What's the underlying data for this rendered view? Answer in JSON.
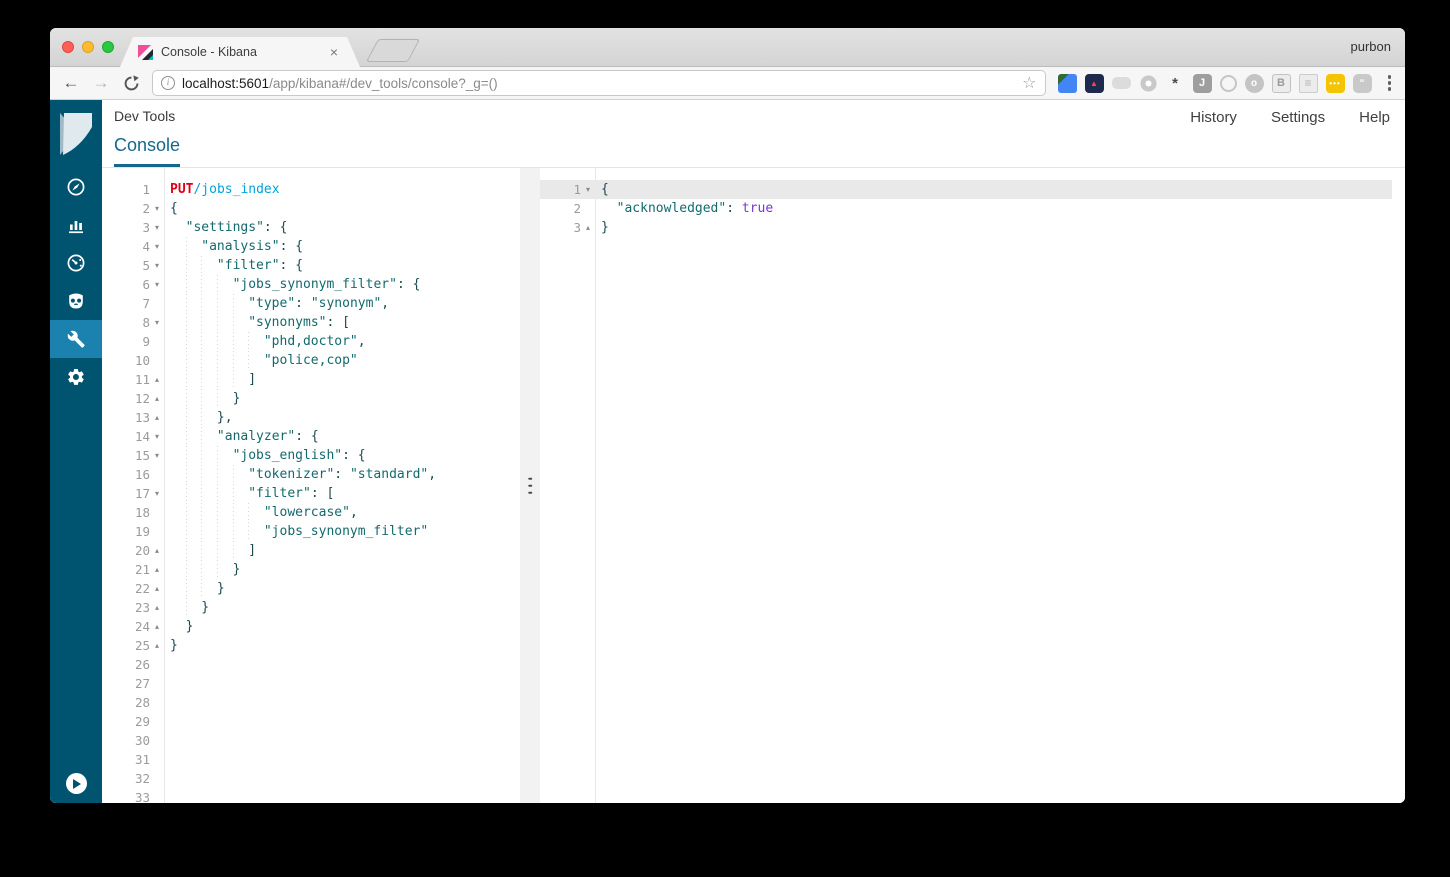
{
  "titlebar": {
    "tab_title": "Console - Kibana",
    "tab_close_glyph": "×",
    "profile": "purbon"
  },
  "toolbar": {
    "back_glyph": "←",
    "forward_glyph": "→",
    "url_host": "localhost:5601",
    "url_path": "/app/kibana#/dev_tools/console?_g=()",
    "star_glyph": "☆",
    "info_glyph": "i"
  },
  "extensions": [
    {
      "name": "color-picker-extension-icon",
      "style": "picker",
      "glyph": ""
    },
    {
      "name": "speed-dial-extension-icon",
      "style": "gauge",
      "glyph": "▲"
    },
    {
      "name": "pill-extension-icon",
      "style": "pill",
      "glyph": ""
    },
    {
      "name": "donut-extension-icon",
      "style": "donut",
      "glyph": ""
    },
    {
      "name": "bug-extension-icon",
      "style": "bug",
      "glyph": "*"
    },
    {
      "name": "j-extension-icon",
      "style": "sq-gray",
      "glyph": "J"
    },
    {
      "name": "ring-extension-icon",
      "style": "ring",
      "glyph": ""
    },
    {
      "name": "power-extension-icon",
      "style": "power",
      "glyph": "o"
    },
    {
      "name": "b-extension-icon",
      "style": "sq-light",
      "glyph": "B"
    },
    {
      "name": "page-extension-icon",
      "style": "page",
      "glyph": "≡"
    },
    {
      "name": "yellow-dots-extension-icon",
      "style": "yellow",
      "glyph": "•••"
    },
    {
      "name": "chat-extension-icon",
      "style": "bubble",
      "glyph": "“"
    }
  ],
  "sidebar": {
    "items": [
      {
        "name": "discover",
        "icon": "compass-icon",
        "active": false
      },
      {
        "name": "visualize",
        "icon": "bar-chart-icon",
        "active": false
      },
      {
        "name": "dashboard",
        "icon": "gauge-icon",
        "active": false
      },
      {
        "name": "timelion",
        "icon": "owl-face-icon",
        "active": false
      },
      {
        "name": "dev-tools",
        "icon": "wrench-icon",
        "active": true
      },
      {
        "name": "management",
        "icon": "gear-icon",
        "active": false
      }
    ]
  },
  "header": {
    "app_title": "Dev Tools",
    "links": [
      "History",
      "Settings",
      "Help"
    ],
    "active_tab": "Console"
  },
  "colors": {
    "accent": "#15688c",
    "sidebar": "#01546f",
    "sidebar_active": "#1b81ae",
    "method": "#e00015",
    "url": "#00a3db",
    "string": "#136a6e",
    "punct": "#1d4a52",
    "bool": "#7a35d6",
    "active_line": "#e9e9e9"
  },
  "fold_glyphs": {
    "open": "▾",
    "close": "▴"
  },
  "request_editor": {
    "lines": [
      {
        "n": 1,
        "f": null,
        "i": 0,
        "t": [
          [
            "PUT",
            "m"
          ],
          [
            " ",
            "p"
          ],
          [
            "/jobs_index",
            "u"
          ]
        ]
      },
      {
        "n": 2,
        "f": "open",
        "i": 0,
        "t": [
          [
            "{",
            "p"
          ]
        ]
      },
      {
        "n": 3,
        "f": "open",
        "i": 2,
        "t": [
          [
            "\"settings\"",
            "s"
          ],
          [
            ": {",
            "p"
          ]
        ]
      },
      {
        "n": 4,
        "f": "open",
        "i": 4,
        "t": [
          [
            "\"analysis\"",
            "s"
          ],
          [
            ": {",
            "p"
          ]
        ]
      },
      {
        "n": 5,
        "f": "open",
        "i": 6,
        "t": [
          [
            "\"filter\"",
            "s"
          ],
          [
            ": {",
            "p"
          ]
        ]
      },
      {
        "n": 6,
        "f": "open",
        "i": 8,
        "t": [
          [
            "\"jobs_synonym_filter\"",
            "s"
          ],
          [
            ": {",
            "p"
          ]
        ]
      },
      {
        "n": 7,
        "f": null,
        "i": 10,
        "t": [
          [
            "\"type\"",
            "s"
          ],
          [
            ": ",
            "p"
          ],
          [
            "\"synonym\"",
            "s"
          ],
          [
            ",",
            "p"
          ]
        ]
      },
      {
        "n": 8,
        "f": "open",
        "i": 10,
        "t": [
          [
            "\"synonyms\"",
            "s"
          ],
          [
            ": [",
            "p"
          ]
        ]
      },
      {
        "n": 9,
        "f": null,
        "i": 12,
        "t": [
          [
            "\"phd,doctor\"",
            "s"
          ],
          [
            ",",
            "p"
          ]
        ]
      },
      {
        "n": 10,
        "f": null,
        "i": 12,
        "t": [
          [
            "\"police,cop\"",
            "s"
          ]
        ]
      },
      {
        "n": 11,
        "f": "close",
        "i": 10,
        "t": [
          [
            "]",
            "p"
          ]
        ]
      },
      {
        "n": 12,
        "f": "close",
        "i": 8,
        "t": [
          [
            "}",
            "p"
          ]
        ]
      },
      {
        "n": 13,
        "f": "close",
        "i": 6,
        "t": [
          [
            "},",
            "p"
          ]
        ]
      },
      {
        "n": 14,
        "f": "open",
        "i": 6,
        "t": [
          [
            "\"analyzer\"",
            "s"
          ],
          [
            ": {",
            "p"
          ]
        ]
      },
      {
        "n": 15,
        "f": "open",
        "i": 8,
        "t": [
          [
            "\"jobs_english\"",
            "s"
          ],
          [
            ": {",
            "p"
          ]
        ]
      },
      {
        "n": 16,
        "f": null,
        "i": 10,
        "t": [
          [
            "\"tokenizer\"",
            "s"
          ],
          [
            ": ",
            "p"
          ],
          [
            "\"standard\"",
            "s"
          ],
          [
            ",",
            "p"
          ]
        ]
      },
      {
        "n": 17,
        "f": "open",
        "i": 10,
        "t": [
          [
            "\"filter\"",
            "s"
          ],
          [
            ": [",
            "p"
          ]
        ]
      },
      {
        "n": 18,
        "f": null,
        "i": 12,
        "t": [
          [
            "\"lowercase\"",
            "s"
          ],
          [
            ",",
            "p"
          ]
        ]
      },
      {
        "n": 19,
        "f": null,
        "i": 12,
        "t": [
          [
            "\"jobs_synonym_filter\"",
            "s"
          ]
        ]
      },
      {
        "n": 20,
        "f": "close",
        "i": 10,
        "t": [
          [
            "]",
            "p"
          ]
        ]
      },
      {
        "n": 21,
        "f": "close",
        "i": 8,
        "t": [
          [
            "}",
            "p"
          ]
        ]
      },
      {
        "n": 22,
        "f": "close",
        "i": 6,
        "t": [
          [
            "}",
            "p"
          ]
        ]
      },
      {
        "n": 23,
        "f": "close",
        "i": 4,
        "t": [
          [
            "}",
            "p"
          ]
        ]
      },
      {
        "n": 24,
        "f": "close",
        "i": 2,
        "t": [
          [
            "}",
            "p"
          ]
        ]
      },
      {
        "n": 25,
        "f": "close",
        "i": 0,
        "t": [
          [
            "}",
            "p"
          ]
        ]
      },
      {
        "n": 26,
        "f": null,
        "i": 0,
        "t": []
      },
      {
        "n": 27,
        "f": null,
        "i": 0,
        "t": []
      },
      {
        "n": 28,
        "f": null,
        "i": 0,
        "t": []
      },
      {
        "n": 29,
        "f": null,
        "i": 0,
        "t": []
      },
      {
        "n": 30,
        "f": null,
        "i": 0,
        "t": []
      },
      {
        "n": 31,
        "f": null,
        "i": 0,
        "t": []
      },
      {
        "n": 32,
        "f": null,
        "i": 0,
        "t": []
      },
      {
        "n": 33,
        "f": null,
        "i": 0,
        "t": []
      }
    ]
  },
  "response_editor": {
    "lines": [
      {
        "n": 1,
        "f": "open",
        "i": 0,
        "hl": true,
        "t": [
          [
            "{",
            "p"
          ]
        ]
      },
      {
        "n": 2,
        "f": null,
        "i": 2,
        "t": [
          [
            "\"acknowledged\"",
            "s"
          ],
          [
            ": ",
            "p"
          ],
          [
            "true",
            "b"
          ]
        ]
      },
      {
        "n": 3,
        "f": "close",
        "i": 0,
        "t": [
          [
            "}",
            "p"
          ]
        ]
      }
    ]
  }
}
